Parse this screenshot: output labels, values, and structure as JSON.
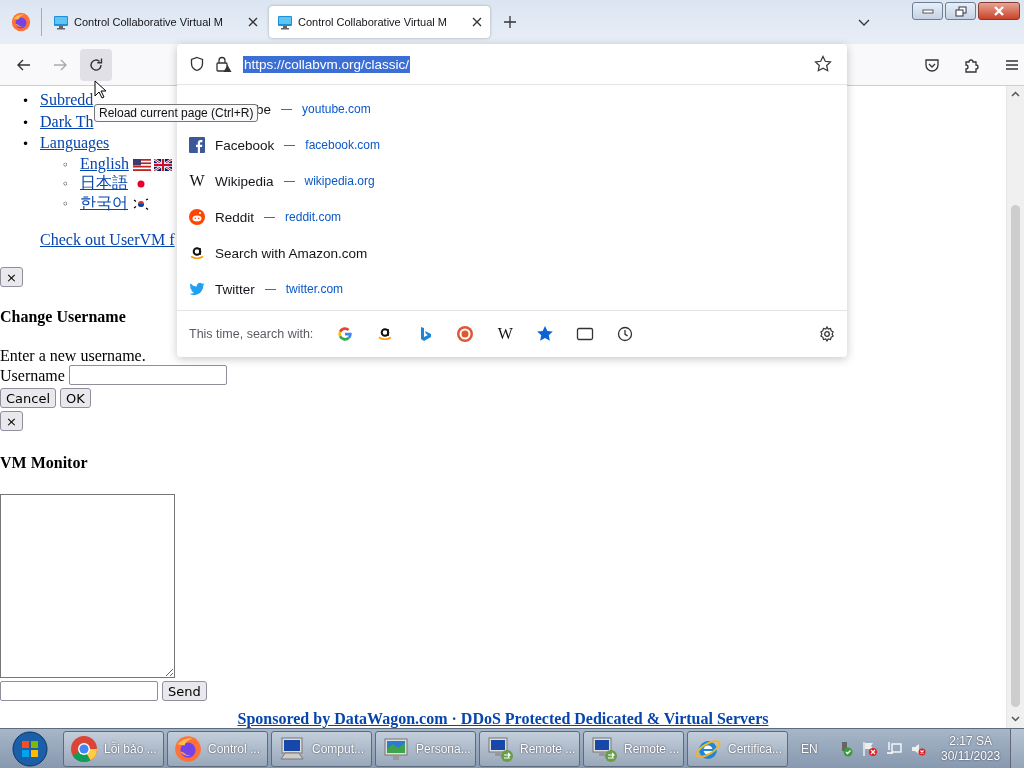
{
  "browser": {
    "tabs": [
      {
        "title": "Control Collaborative Virtual M",
        "selected": false
      },
      {
        "title": "Control Collaborative Virtual M",
        "selected": true
      }
    ],
    "address_bar": {
      "url": "https://collabvm.org/classic/"
    },
    "tooltip": "Reload current page (Ctrl+R)",
    "suggestions": [
      {
        "kind": "covered",
        "title": "be",
        "url": "youtube.com"
      },
      {
        "kind": "facebook",
        "title": "Facebook",
        "url": "facebook.com"
      },
      {
        "kind": "wikipedia",
        "glyph": "W",
        "title": "Wikipedia",
        "url": "wikipedia.org"
      },
      {
        "kind": "reddit",
        "title": "Reddit",
        "url": "reddit.com"
      },
      {
        "kind": "amazon",
        "title": "Search with Amazon.com"
      },
      {
        "kind": "twitter",
        "title": "Twitter",
        "url": "twitter.com"
      }
    ],
    "search_with": {
      "label": "This time, search with:",
      "engines": [
        {
          "kind": "google"
        },
        {
          "kind": "amazon"
        },
        {
          "kind": "bing"
        },
        {
          "kind": "duckduckgo"
        },
        {
          "kind": "wikipedia",
          "glyph": "W"
        },
        {
          "kind": "bookmarks"
        },
        {
          "kind": "tabs"
        },
        {
          "kind": "history"
        }
      ]
    }
  },
  "page": {
    "nav_links": [
      {
        "marker": "•",
        "text": "Subredd"
      },
      {
        "marker": "•",
        "text": "Dark Th"
      },
      {
        "marker": "•",
        "text": "Languages",
        "children": [
          {
            "marker": "◦",
            "text": "English",
            "kind": "en"
          },
          {
            "marker": "◦",
            "text": "日本語",
            "kind": "ja"
          },
          {
            "marker": "◦",
            "text": "한국어",
            "kind": "ko"
          }
        ]
      }
    ],
    "uservm_link": "Check out UserVM f",
    "username_dialog": {
      "close": "×",
      "title": "Change Username",
      "prompt": "Enter a new username.",
      "field_label": "Username",
      "buttons": [
        "Cancel",
        "OK"
      ]
    },
    "vm_monitor": {
      "close": "×",
      "title": "VM Monitor",
      "send": "Send"
    },
    "sponsor": "Sponsored by DataWagon.com · DDoS Protected Dedicated & Virtual Servers"
  },
  "taskbar": {
    "items": [
      {
        "kind": "chrome",
        "label": "Lỗi bảo ..."
      },
      {
        "kind": "firefox",
        "label": "Control ..."
      },
      {
        "kind": "computer",
        "label": "Comput..."
      },
      {
        "kind": "personalize",
        "label": "Persona..."
      },
      {
        "kind": "remote",
        "label": "Remote ..."
      },
      {
        "kind": "remote",
        "label": "Remote ..."
      },
      {
        "kind": "ie",
        "label": "Certifica..."
      }
    ],
    "language": "EN",
    "time": "2:17 SA",
    "date": "30/11/2023"
  }
}
